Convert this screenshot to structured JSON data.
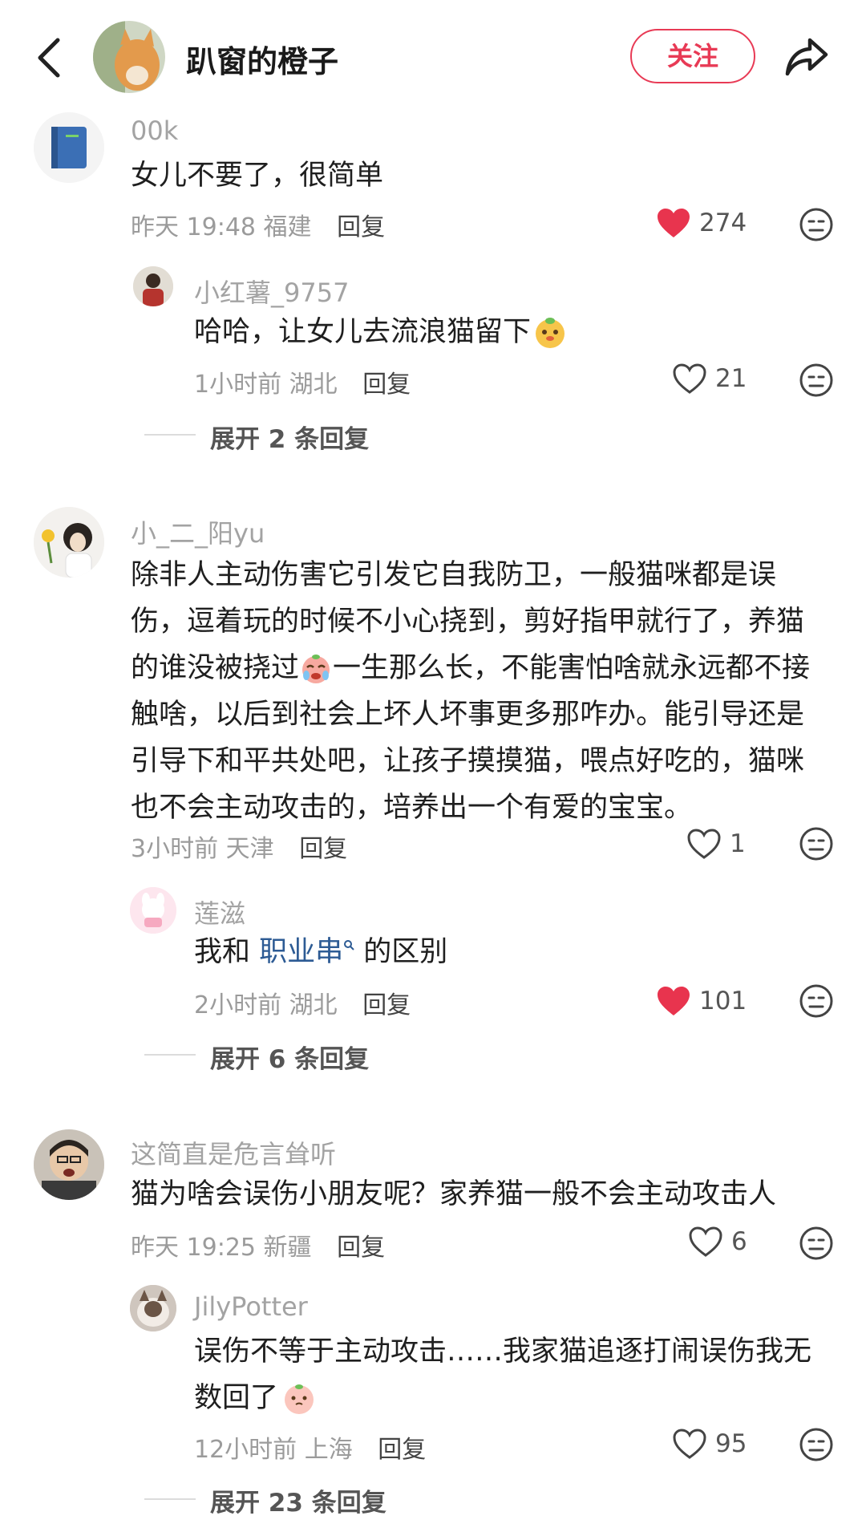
{
  "header": {
    "title": "趴窗的橙子",
    "follow_label": "关注",
    "icons": [
      "back-arrow-icon",
      "share-icon"
    ]
  },
  "comments": [
    {
      "user": "00k",
      "text": "女儿不要了，很简单",
      "time": "昨天 19:48",
      "location": "福建",
      "reply": "回复",
      "likes": "274",
      "liked": true,
      "replies": [
        {
          "user": "小红薯_9757",
          "text": "哈哈，让女儿去流浪猫留下",
          "time": "1小时前",
          "location": "湖北",
          "reply": "回复",
          "likes": "21",
          "liked": false
        }
      ],
      "expand_label": "展开 2 条回复"
    },
    {
      "user": "小_二_阳yu",
      "text_lines": [
        "除非人主动伤害它引发它自我防卫，一般猫咪都是误",
        "伤，逗着玩的时候不小心挠到，剪好指甲就行了，养猫",
        "的谁没被挠过",
        "一生那么长，不能害怕啥就永远都不接",
        "触啥，以后到社会上坏人坏事更多那咋办。能引导还是",
        "引导下和平共处吧，让孩子摸摸猫，喂点好吃的，猫咪",
        "也不会主动攻击的，培养出一个有爱的宝宝。"
      ],
      "time": "3小时前",
      "location": "天津",
      "reply": "回复",
      "likes": "1",
      "liked": false,
      "replies": [
        {
          "user": "莲滋",
          "text_prefix": "我和 ",
          "topic": "职业串",
          "text_suffix": " 的区别",
          "time": "2小时前",
          "location": "湖北",
          "reply": "回复",
          "likes": "101",
          "liked": true
        }
      ],
      "expand_label": "展开 6 条回复"
    },
    {
      "user": "这简直是危言耸听",
      "text": "猫为啥会误伤小朋友呢？家养猫一般不会主动攻击人",
      "time": "昨天 19:25",
      "location": "新疆",
      "reply": "回复",
      "likes": "6",
      "liked": false,
      "replies": [
        {
          "user": "JilyPotter",
          "text_lines": [
            "误伤不等于主动攻击……我家猫追逐打闹误伤我无",
            "数回了"
          ],
          "time": "12小时前",
          "location": "上海",
          "reply": "回复",
          "likes": "95",
          "liked": false
        }
      ],
      "expand_label": "展开 23 条回复"
    }
  ],
  "colors": {
    "accent": "#e83a55",
    "liked_heart": "#e8344e",
    "topic_link": "#2d5b94",
    "muted_text": "#9b9b9b"
  }
}
